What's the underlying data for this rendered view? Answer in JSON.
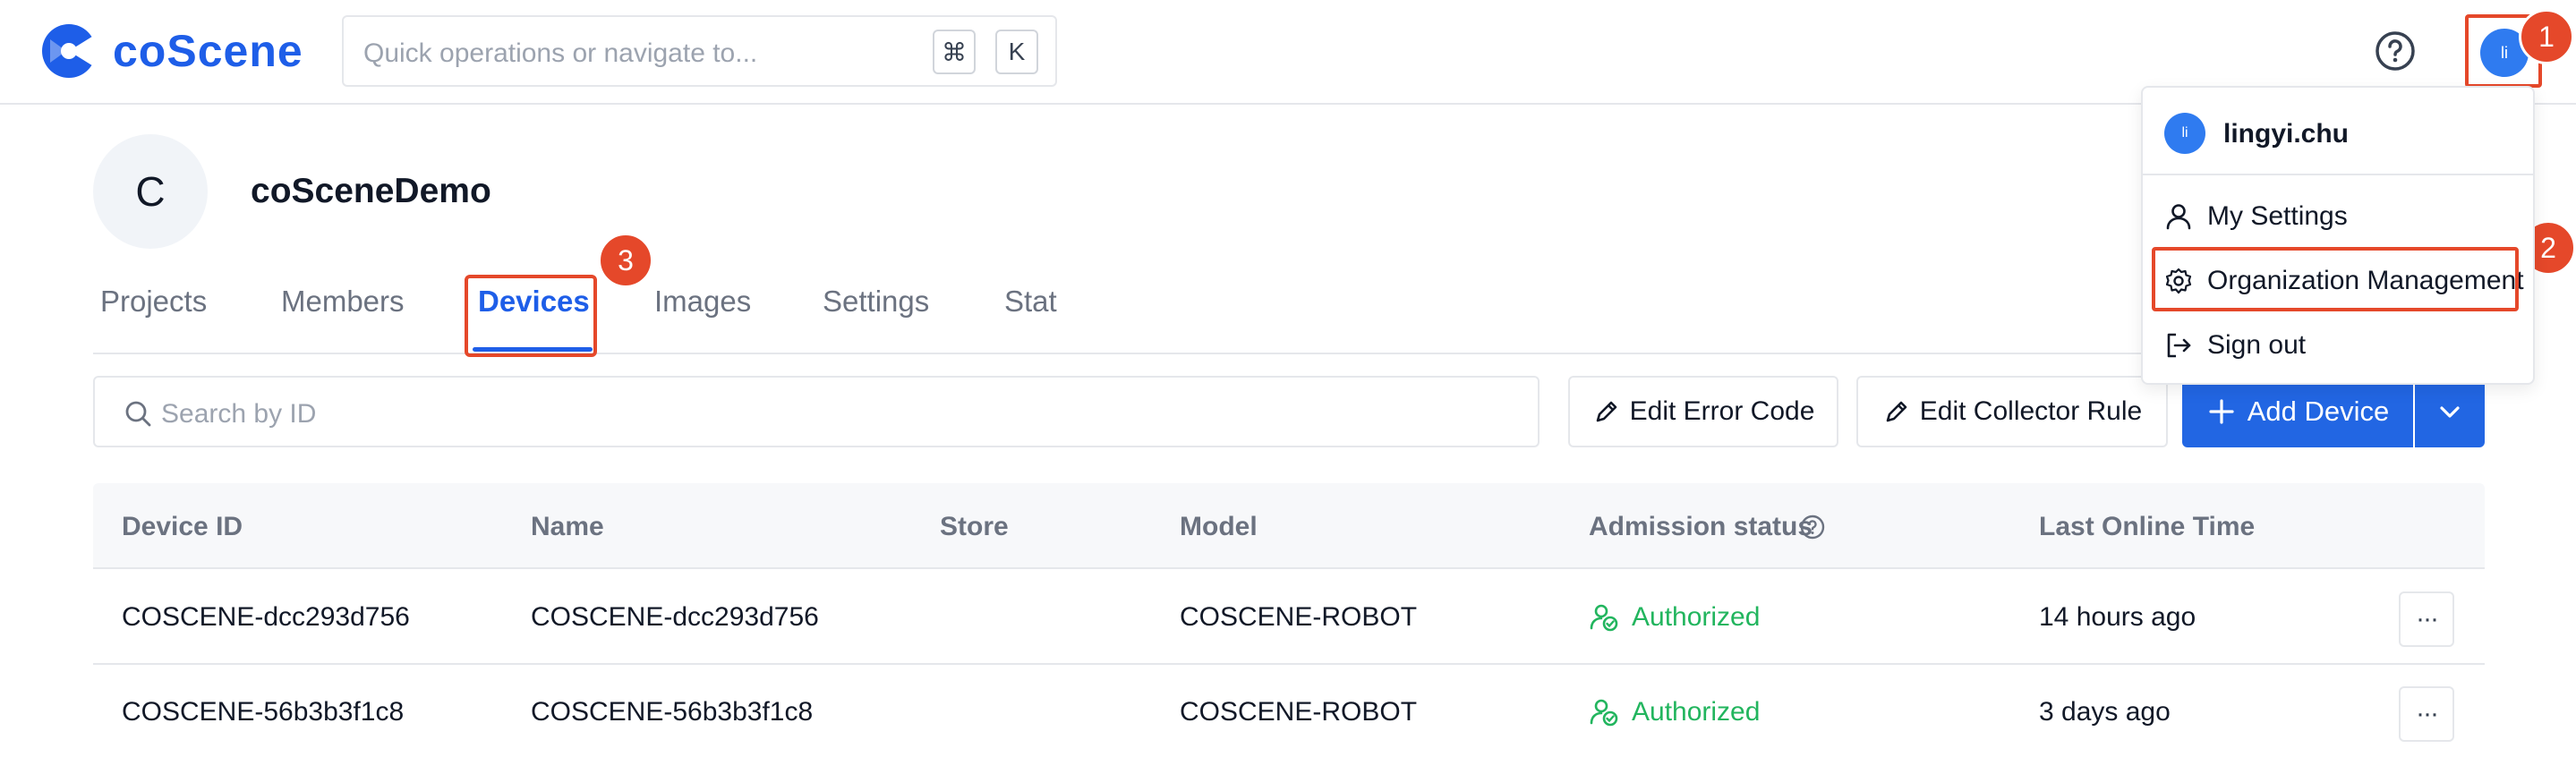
{
  "app": {
    "brand": "coScene",
    "brand_color": "#1e5ee8",
    "accent_color": "#2266e3",
    "highlight_color": "#e5482a"
  },
  "search": {
    "placeholder": "Quick operations or navigate to...",
    "shortcut_mod": "⌘",
    "shortcut_key": "K"
  },
  "user": {
    "initials": "li",
    "name": "lingyi.chu"
  },
  "org": {
    "initial": "C",
    "name": "coSceneDemo"
  },
  "tabs": [
    {
      "label": "Projects",
      "active": false
    },
    {
      "label": "Members",
      "active": false
    },
    {
      "label": "Devices",
      "active": true
    },
    {
      "label": "Images",
      "active": false
    },
    {
      "label": "Settings",
      "active": false
    },
    {
      "label": "Stat",
      "active": false
    }
  ],
  "toolbar": {
    "search_placeholder": "Search by ID",
    "edit_error_code": "Edit Error Code",
    "edit_collector_rule": "Edit Collector Rule",
    "add_device": "Add Device"
  },
  "table": {
    "columns": [
      "Device ID",
      "Name",
      "Store",
      "Model",
      "Admission status",
      "Last Online Time"
    ],
    "rows": [
      {
        "device_id": "COSCENE-dcc293d756",
        "name": "COSCENE-dcc293d756",
        "store": "",
        "model": "COSCENE-ROBOT",
        "status": "Authorized",
        "last_online": "14 hours ago"
      },
      {
        "device_id": "COSCENE-56b3b3f1c8",
        "name": "COSCENE-56b3b3f1c8",
        "store": "",
        "model": "COSCENE-ROBOT",
        "status": "Authorized",
        "last_online": "3 days ago"
      }
    ],
    "more_label": "···"
  },
  "menu": {
    "items": [
      {
        "label": "My Settings",
        "icon": "user-icon"
      },
      {
        "label": "Organization Management",
        "icon": "gear-icon"
      },
      {
        "label": "Sign out",
        "icon": "sign-out-icon"
      }
    ]
  },
  "annotations": [
    "1",
    "2",
    "3"
  ]
}
